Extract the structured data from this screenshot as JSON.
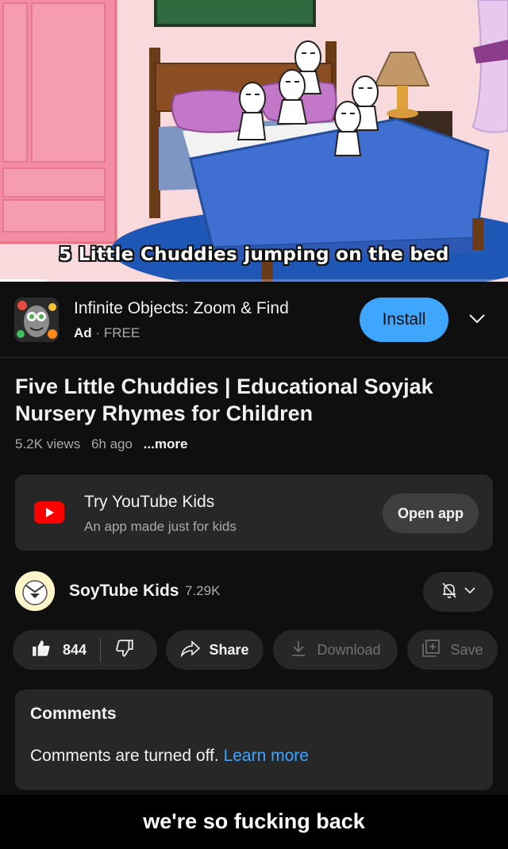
{
  "video": {
    "caption": "5 Little Chuddies jumping on the bed",
    "progress": 0.09
  },
  "ad": {
    "app_name": "Infinite Objects: Zoom & Find",
    "ad_label": "Ad",
    "separator": "·",
    "price": "FREE",
    "install_label": "Install",
    "chevron_icon": "chevron-down-icon"
  },
  "video_info": {
    "title": "Five Little Chuddies | Educational Soyjak Nursery Rhymes for Children",
    "views": "5.2K views",
    "age": "6h ago",
    "more": "...more"
  },
  "kids_promo": {
    "title": "Try YouTube Kids",
    "subtitle": "An app made just for kids",
    "button": "Open app",
    "logo_color": "#ff0000"
  },
  "channel": {
    "name": "SoyTube Kids",
    "subscribers": "7.29K",
    "bell_icon": "bell-off-icon"
  },
  "actions": {
    "like_count": "844",
    "share": "Share",
    "download": "Download",
    "save": "Save"
  },
  "comments": {
    "heading": "Comments",
    "message": "Comments are turned off.",
    "link": "Learn more"
  },
  "meme_caption": "we're so fucking back",
  "colors": {
    "background": "#0f0f0f",
    "surface": "#272727",
    "accent_blue": "#3ea6ff",
    "muted_text": "#aaaaaa"
  }
}
